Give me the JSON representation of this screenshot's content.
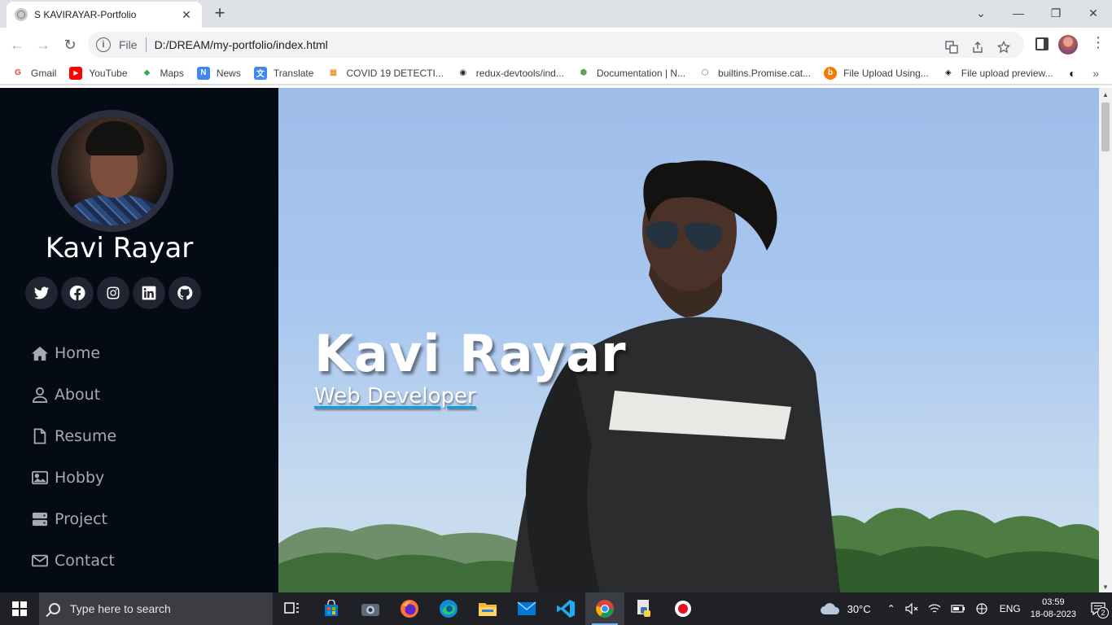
{
  "browser": {
    "tab": {
      "title": "S KAVIRAYAR-Portfolio",
      "close": "✕"
    },
    "newtab": "+",
    "window_controls": {
      "dropdown": "⌄",
      "minimize": "—",
      "restore": "❐",
      "close": "✕"
    },
    "nav": {
      "back": "←",
      "forward": "→",
      "reload": "↻"
    },
    "address": {
      "scheme": "File",
      "url": "D:/DREAM/my-portfolio/index.html"
    },
    "bookmarks": [
      {
        "label": "Gmail",
        "icon": "gmail-icon",
        "color": "#ea4335",
        "glyph": "G"
      },
      {
        "label": "YouTube",
        "icon": "youtube-icon",
        "color": "#ff0000",
        "glyph": "▶"
      },
      {
        "label": "Maps",
        "icon": "maps-icon",
        "color": "#34a853",
        "glyph": "◆"
      },
      {
        "label": "News",
        "icon": "news-icon",
        "color": "#4285f4",
        "glyph": "N"
      },
      {
        "label": "Translate",
        "icon": "translate-icon",
        "color": "#4285f4",
        "glyph": "文"
      },
      {
        "label": "COVID 19 DETECTI...",
        "icon": "grid-icon",
        "color": "#e37400",
        "glyph": "▦"
      },
      {
        "label": "redux-devtools/ind...",
        "icon": "github-icon",
        "color": "#24292e",
        "glyph": "◉"
      },
      {
        "label": "Documentation | N...",
        "icon": "nodejs-icon",
        "color": "#5fa04e",
        "glyph": "⬢"
      },
      {
        "label": "builtins.Promise.cat...",
        "icon": "hexagon-icon",
        "color": "#9b59b6",
        "glyph": "⬡"
      },
      {
        "label": "File Upload Using...",
        "icon": "b-icon",
        "color": "#f57c00",
        "glyph": "b"
      },
      {
        "label": "File upload preview...",
        "icon": "codepen-icon",
        "color": "#111111",
        "glyph": "◈"
      },
      {
        "label": "",
        "icon": "globe-icon",
        "color": "#111111",
        "glyph": "◐"
      }
    ],
    "bookmarks_more": "»"
  },
  "sidebar": {
    "name": "Kavi Rayar",
    "socials": [
      "twitter-icon",
      "facebook-icon",
      "instagram-icon",
      "linkedin-icon",
      "github-icon"
    ],
    "nav": [
      {
        "label": "Home",
        "icon": "home-icon"
      },
      {
        "label": "About",
        "icon": "user-icon"
      },
      {
        "label": "Resume",
        "icon": "file-icon"
      },
      {
        "label": "Hobby",
        "icon": "image-icon"
      },
      {
        "label": "Project",
        "icon": "server-icon"
      },
      {
        "label": "Contact",
        "icon": "envelope-icon"
      }
    ]
  },
  "hero": {
    "title": "Kavi Rayar",
    "subtitle": "Web Developer"
  },
  "taskbar": {
    "search_placeholder": "Type here to search",
    "weather": "30°C",
    "language": "ENG",
    "time": "03:59",
    "date": "18-08-2023",
    "notifications": "2"
  },
  "colors": {
    "sidebar_bg": "#040b14",
    "accent": "#149ddd",
    "nav_text": "#a8a9b4"
  }
}
